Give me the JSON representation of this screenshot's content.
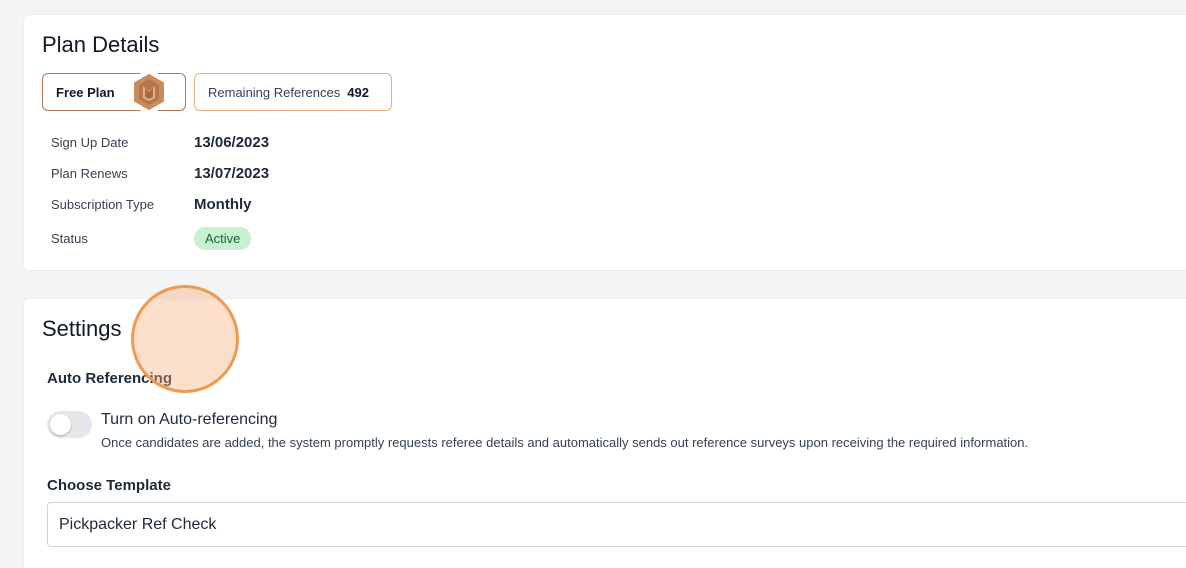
{
  "plan_details": {
    "title": "Plan Details",
    "plan_badge": "Free Plan",
    "remaining_label": "Remaining References",
    "remaining_count": "492",
    "rows": [
      {
        "label": "Sign Up Date",
        "value": "13/06/2023"
      },
      {
        "label": "Plan Renews",
        "value": "13/07/2023"
      },
      {
        "label": "Subscription Type",
        "value": "Monthly"
      },
      {
        "label": "Status",
        "value": "Active"
      }
    ]
  },
  "settings": {
    "title": "Settings",
    "auto_ref_heading": "Auto Referencing",
    "toggle_label": "Turn on Auto-referencing",
    "toggle_state": "off",
    "toggle_description": "Once candidates are added, the system promptly requests referee details and automatically sends out reference surveys upon receiving the required information.",
    "template_heading": "Choose Template",
    "template_value": "Pickpacker Ref Check"
  },
  "colors": {
    "plan_border": "#b07a52",
    "refs_border": "#e0b07a",
    "status_bg": "#c8f1d2",
    "click_ring": "#ef9a4f"
  },
  "icons": {
    "plan_medal": "bronze-hexagon-medal-icon"
  }
}
